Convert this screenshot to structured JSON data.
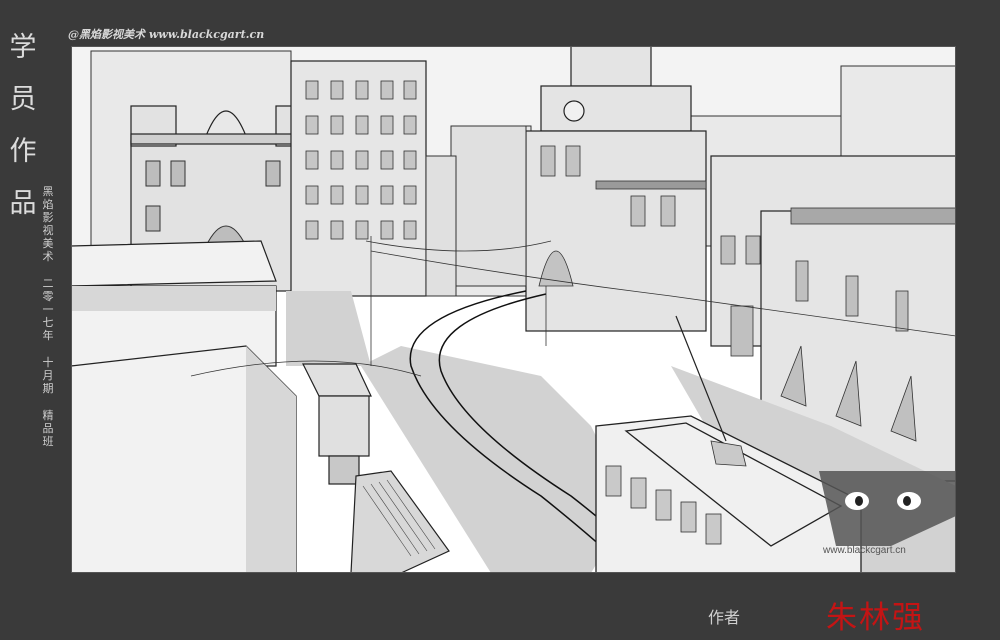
{
  "left_title": "学员作品",
  "left_subtitle": [
    "黑焰影视美术",
    "二零一七年",
    "十月期",
    "精品班"
  ],
  "top_credit": "@黑焰影视美术  www.blackcgart.cn",
  "artwork": {
    "watermark_text": "www.blackcgart.cn",
    "logo_icon": "owl-eyes-icon"
  },
  "author_label": "作者",
  "author_name": "朱林强",
  "colors": {
    "background": "#3a3a3a",
    "author_name": "#c41414",
    "canvas": "#ffffff",
    "shadow_gray": "#d2d2d2"
  }
}
